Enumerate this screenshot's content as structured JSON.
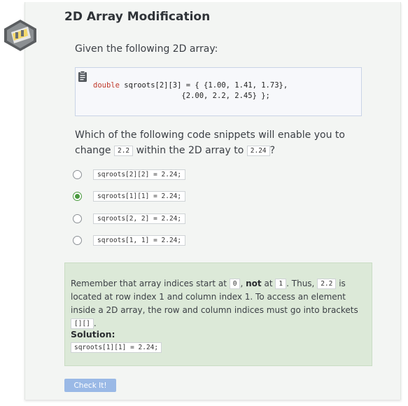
{
  "page": {
    "title": "2D Array Modification",
    "intro": "Given the following 2D array:"
  },
  "code_block": {
    "keyword": "double",
    "line1_rest": " sqroots[2][3] = { {1.00, 1.41, 1.73},",
    "line2": "                    {2.00, 2.2, 2.45} };"
  },
  "question": {
    "prefix": "Which of the following code snippets will enable you to change",
    "code_from": "2.2",
    "middle": "within the 2D array to",
    "code_to": "2.24",
    "suffix": "?"
  },
  "options": [
    {
      "code": "sqroots[2][2] = 2.24;",
      "selected": false
    },
    {
      "code": "sqroots[1][1] = 2.24;",
      "selected": true
    },
    {
      "code": "sqroots[2, 2] = 2.24;",
      "selected": false
    },
    {
      "code": "sqroots[1, 1] = 2.24;",
      "selected": false
    }
  ],
  "feedback": {
    "t1": "Remember that array indices start at",
    "c1": "0",
    "t2": ",",
    "bold": "not",
    "t3": "at",
    "c2": "1",
    "t4": ". Thus,",
    "c3": "2.2",
    "t5": "is located at row index 1 and column index 1. To access an element inside a 2D array, the row and column indices must go into brackets",
    "c4": "[][]",
    "t6": ".",
    "solution_label": "Solution:",
    "solution_code": "sqroots[1][1] = 2.24;"
  },
  "check_button": "Check It!",
  "colors": {
    "card_bg": "#f3f5f3",
    "feedback_bg": "#dce9d8",
    "button_bg": "#9ab9e6",
    "selected_green": "#4a9a3f",
    "keyword_red": "#c0392b"
  },
  "icons": {
    "logo": "film-reel-logo-icon",
    "code_box": "clipboard-icon",
    "selected": "check-circle-icon"
  }
}
